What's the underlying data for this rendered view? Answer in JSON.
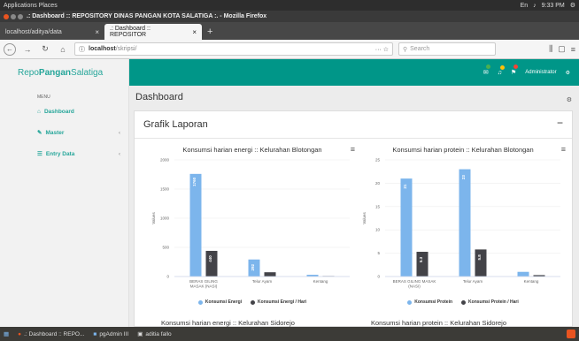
{
  "os": {
    "menu": "Applications  Places",
    "time": "9:33 PM",
    "tray": "En"
  },
  "window": {
    "title": ".: Dashboard :: REPOSITORY DINAS PANGAN KOTA SALATIGA :. - Mozilla Firefox"
  },
  "tabs": [
    {
      "label": "localhost/aditya/data",
      "active": false
    },
    {
      "label": ".: Dashboard :: REPOSITOR",
      "active": true
    }
  ],
  "address": {
    "host": "localhost",
    "path": "/skripsi/",
    "search_placeholder": "Search"
  },
  "sidebar": {
    "brand_a": "Repo",
    "brand_b": "Pangan",
    "brand_c": "Salatiga",
    "menu_label": "MENU",
    "items": [
      {
        "label": "Dashboard",
        "icon": "home-icon",
        "caret": ""
      },
      {
        "label": "Master",
        "icon": "edit-icon",
        "caret": "‹"
      },
      {
        "label": "Entry Data",
        "icon": "list-icon",
        "caret": "‹"
      }
    ]
  },
  "topbar": {
    "user": "Administrator"
  },
  "page": {
    "title": "Dashboard"
  },
  "card": {
    "title": "Grafik Laporan",
    "collapse": "−"
  },
  "chart_data": [
    {
      "type": "bar",
      "title": "Konsumsi harian energi :: Kelurahan Blotongan",
      "ylabel": "Values",
      "ylim": [
        0,
        2000
      ],
      "yticks": [
        0,
        500,
        1000,
        1500,
        2000
      ],
      "categories": [
        "BERAS GILING MASAK (NASI)",
        "Telur Ayam",
        "Kentang"
      ],
      "category_labels": [
        [
          "BERAS GILING",
          "MASAK (NASI)"
        ],
        [
          "Telur Ayam"
        ],
        [
          "Kentang"
        ]
      ],
      "series": [
        {
          "name": "Konsumsi Energi",
          "color": "#7cb5ec",
          "values": [
            1760,
            292,
            30
          ],
          "labels": [
            "1760",
            "292",
            ""
          ]
        },
        {
          "name": "Konsumsi Energi / Hari",
          "color": "#434348",
          "values": [
            440,
            73,
            8
          ],
          "labels": [
            "440",
            "",
            ""
          ]
        }
      ]
    },
    {
      "type": "bar",
      "title": "Konsumsi harian protein :: Kelurahan Blotongan",
      "ylabel": "Values",
      "ylim": [
        0,
        25
      ],
      "yticks": [
        0,
        5,
        10,
        15,
        20,
        25
      ],
      "categories": [
        "BERAS GILING MASAK (NASI)",
        "Telur Ayam",
        "Kentang"
      ],
      "category_labels": [
        [
          "BERAS GILING MASAK",
          "(NASI)"
        ],
        [
          "Telur Ayam"
        ],
        [
          "Kentang"
        ]
      ],
      "series": [
        {
          "name": "Konsumsi Protein",
          "color": "#7cb5ec",
          "values": [
            21,
            23,
            1
          ],
          "labels": [
            "21",
            "23",
            ""
          ]
        },
        {
          "name": "Konsumsi Protein / Hari",
          "color": "#434348",
          "values": [
            5.3,
            5.8,
            0.3
          ],
          "labels": [
            "5.3",
            "5.8",
            ""
          ]
        }
      ]
    }
  ],
  "next": {
    "left": "Konsumsi harian energi :: Kelurahan Sidorejo",
    "right": "Konsumsi harian protein :: Kelurahan Sidorejo"
  },
  "taskbar": {
    "items": [
      ".: Dashboard :: REPO...",
      "pgAdmin III",
      "aditia fallo"
    ]
  }
}
